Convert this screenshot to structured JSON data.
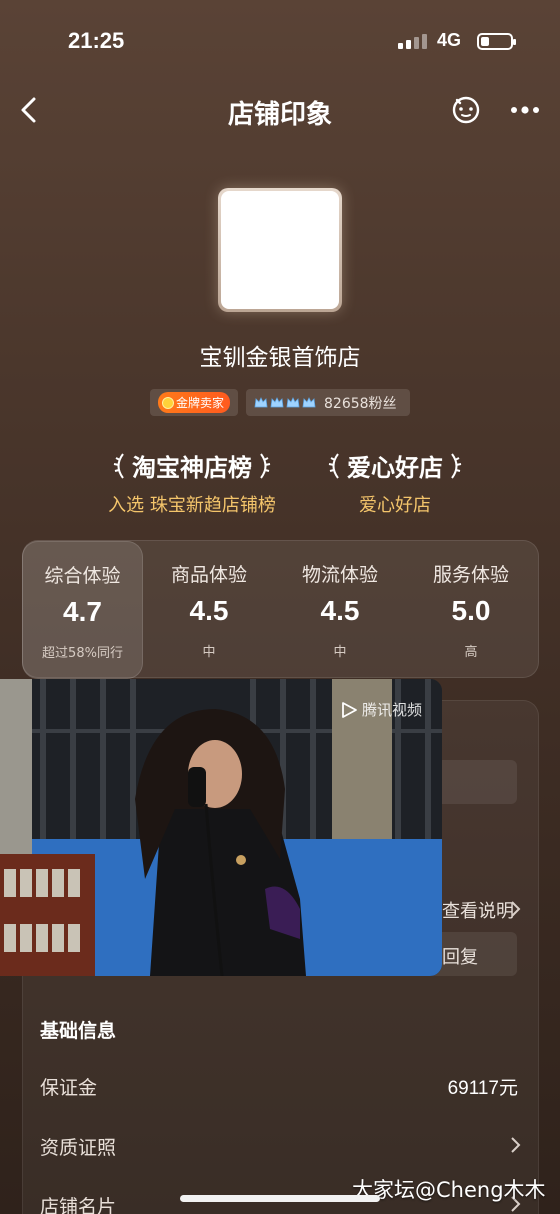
{
  "status_bar": {
    "time": "21:25",
    "network": "4G"
  },
  "nav": {
    "title": "店铺印象"
  },
  "shop": {
    "name": "宝钏金银首饰店"
  },
  "badges": {
    "seller_level": "金牌卖家",
    "fans": "82658粉丝"
  },
  "honors": [
    {
      "title": "淘宝神店榜",
      "subtitle": "入选 珠宝新趋店铺榜"
    },
    {
      "title": "爱心好店",
      "subtitle": "爱心好店"
    }
  ],
  "ratings": [
    {
      "label": "综合体验",
      "value": "4.7",
      "note": "超过58%同行"
    },
    {
      "label": "商品体验",
      "value": "4.5",
      "note": "中"
    },
    {
      "label": "物流体验",
      "value": "4.5",
      "note": "中"
    },
    {
      "label": "服务体验",
      "value": "5.0",
      "note": "高"
    }
  ],
  "partially_hidden": {
    "explain_link": "查看说明",
    "reply_button": "回复"
  },
  "basic_info": {
    "title": "基础信息",
    "rows": [
      {
        "label": "保证金",
        "value": "69117元"
      },
      {
        "label": "资质证照",
        "value": ""
      },
      {
        "label": "店铺名片",
        "value": ""
      }
    ]
  },
  "video": {
    "watermark": "腾讯视频"
  },
  "watermark_credit": "大家坛@Cheng木木",
  "colors": {
    "accent_gold": "#f4c56b",
    "badge_orange": "#ff6a1f"
  }
}
